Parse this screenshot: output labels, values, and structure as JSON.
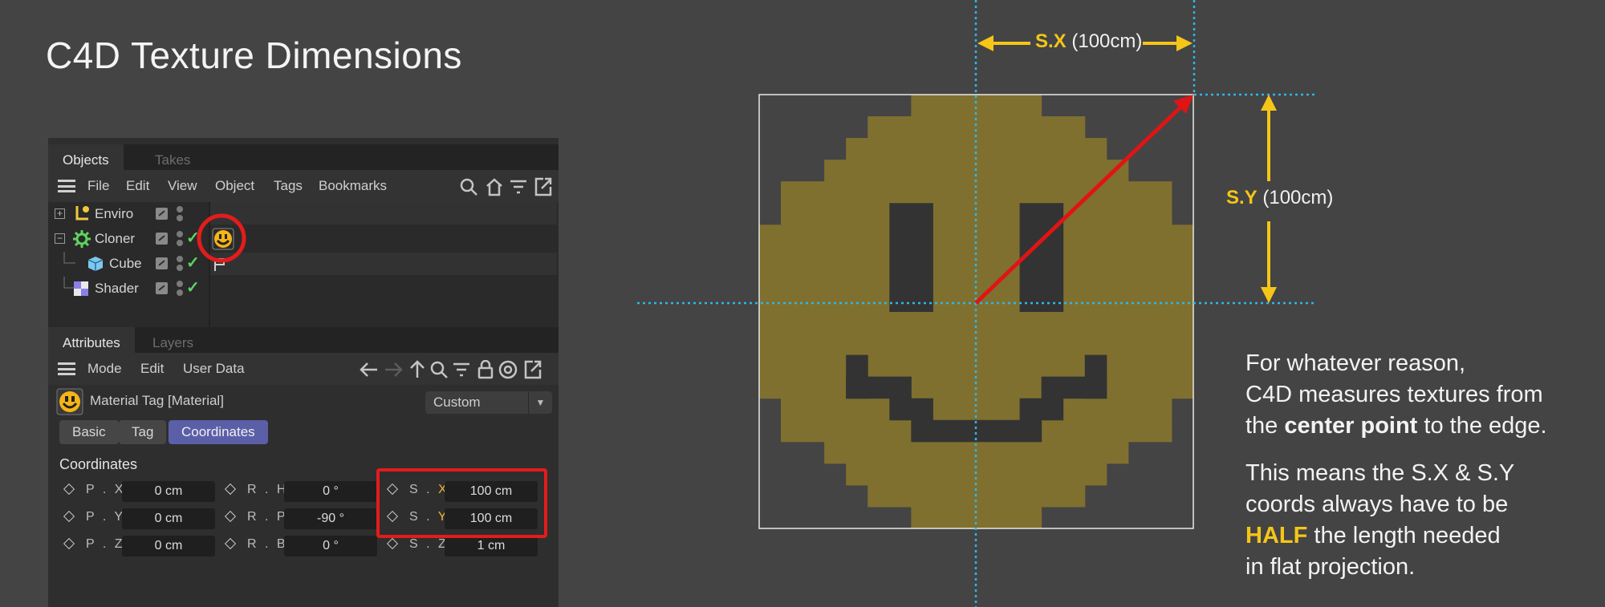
{
  "title": "C4D Texture Dimensions",
  "objects_panel": {
    "tabs": [
      {
        "label": "Objects",
        "active": true
      },
      {
        "label": "Takes",
        "active": false
      }
    ],
    "menu": [
      "File",
      "Edit",
      "View",
      "Object",
      "Tags",
      "Bookmarks"
    ],
    "tree": [
      {
        "name": "Enviro",
        "icon": "null-object-icon"
      },
      {
        "name": "Cloner",
        "icon": "cloner-icon"
      },
      {
        "name": "Cube",
        "icon": "cube-icon"
      },
      {
        "name": "Shader",
        "icon": "shader-icon"
      }
    ]
  },
  "attributes_panel": {
    "tabs": [
      {
        "label": "Attributes",
        "active": true
      },
      {
        "label": "Layers",
        "active": false
      }
    ],
    "menu": [
      "Mode",
      "Edit",
      "User Data"
    ],
    "tag_name": "Material Tag [Material]",
    "dropdown_value": "Custom",
    "sub_tabs": [
      {
        "label": "Basic",
        "active": false
      },
      {
        "label": "Tag",
        "active": false
      },
      {
        "label": "Coordinates",
        "active": true
      }
    ],
    "section_title": "Coordinates",
    "fields": {
      "px_label": "P . X",
      "px": "0 cm",
      "py_label": "P . Y",
      "py": "0 cm",
      "pz_label": "P . Z",
      "pz": "0 cm",
      "rh_label": "R . H",
      "rh": "0 °",
      "rp_label": "R . P",
      "rp": "-90 °",
      "rb_label": "R . B",
      "rb": "0 °",
      "sx_prefix": "S . ",
      "sx_axis": "X",
      "sx": "100 cm",
      "sy_prefix": "S . ",
      "sy_axis": "Y",
      "sy": "100 cm",
      "sz_label": "S . Z",
      "sz": "1 cm"
    }
  },
  "diagram": {
    "sx_axis": "S.X",
    "sx_value": "(100cm)",
    "sy_axis": "S.Y",
    "sy_value": "(100cm)",
    "colors": {
      "smiley": "#80702f",
      "guide": "#2fb6e8",
      "arrow_yellow": "#f5c518",
      "arrow_red": "#e01414"
    }
  },
  "explanation": {
    "p1_line1": "For whatever reason,",
    "p1_line2": "C4D measures textures from",
    "p1_line3_pre": "the ",
    "p1_line3_bold": "center point",
    "p1_line3_post": " to the edge.",
    "p2_line1": "This means the S.X &  S.Y",
    "p2_line2": "coords always have to be",
    "p2_line3_bold": "HALF",
    "p2_line3_post": " the length needed",
    "p2_line4": "in flat projection."
  }
}
